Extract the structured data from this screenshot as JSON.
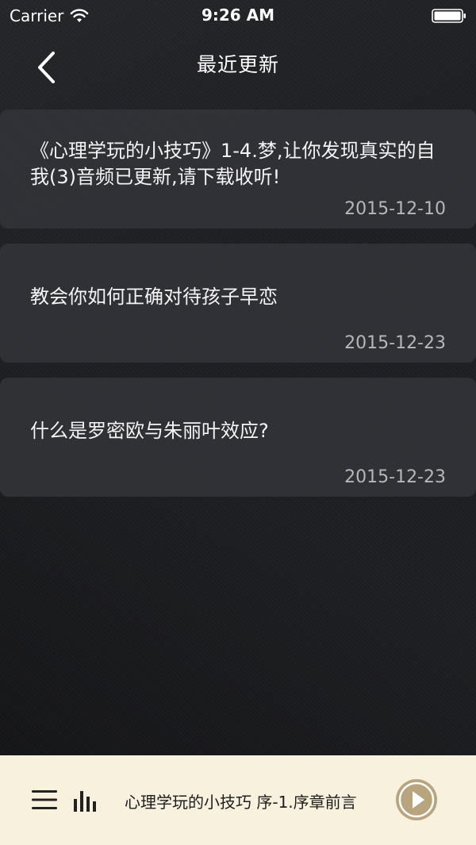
{
  "status_bar": {
    "carrier": "Carrier",
    "time": "9:26 AM"
  },
  "nav": {
    "title": "最近更新",
    "back_icon": "chevron-left-icon"
  },
  "updates": [
    {
      "title": "《心理学玩的小技巧》1-4.梦,让你发现真实的自我(3)音频已更新,请下载收听!",
      "date": "2015-12-10"
    },
    {
      "title": "教会你如何正确对待孩子早恋",
      "date": "2015-12-23"
    },
    {
      "title": "什么是罗密欧与朱丽叶效应?",
      "date": "2015-12-23"
    }
  ],
  "player": {
    "now_playing": "心理学玩的小技巧 序-1.序章前言",
    "icons": [
      "menu-icon",
      "bar-chart-icon",
      "play-icon"
    ],
    "accent_color": "#b8a57e",
    "background_color": "#f7f1dd"
  }
}
